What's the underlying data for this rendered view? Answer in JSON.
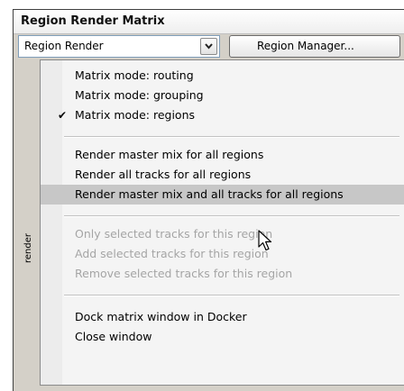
{
  "window": {
    "title": "Region Render Matrix"
  },
  "toolbar": {
    "region_select_value": "Region Render",
    "region_manager_label": "Region Manager..."
  },
  "side_panel": {
    "label": "render"
  },
  "menu": {
    "items": [
      {
        "label": "Matrix mode: routing",
        "checked": false,
        "enabled": true
      },
      {
        "label": "Matrix mode: grouping",
        "checked": false,
        "enabled": true
      },
      {
        "label": "Matrix mode: regions",
        "checked": true,
        "enabled": true
      },
      {
        "label": "Render master mix for all regions",
        "checked": false,
        "enabled": true
      },
      {
        "label": "Render all tracks for all regions",
        "checked": false,
        "enabled": true
      },
      {
        "label": "Render master mix and all tracks for all regions",
        "checked": false,
        "enabled": true,
        "highlighted": true
      },
      {
        "label": "Only selected tracks for this region",
        "checked": false,
        "enabled": false
      },
      {
        "label": "Add selected tracks for this region",
        "checked": false,
        "enabled": false
      },
      {
        "label": "Remove selected tracks for this region",
        "checked": false,
        "enabled": false
      },
      {
        "label": "Dock matrix window in Docker",
        "checked": false,
        "enabled": true
      },
      {
        "label": "Close window",
        "checked": false,
        "enabled": true
      }
    ],
    "check_glyph": "✔"
  },
  "colors": {
    "highlight": "#c7c7c7",
    "disabled_text": "#a5a5a5",
    "window_bg": "#d4d0c8"
  }
}
